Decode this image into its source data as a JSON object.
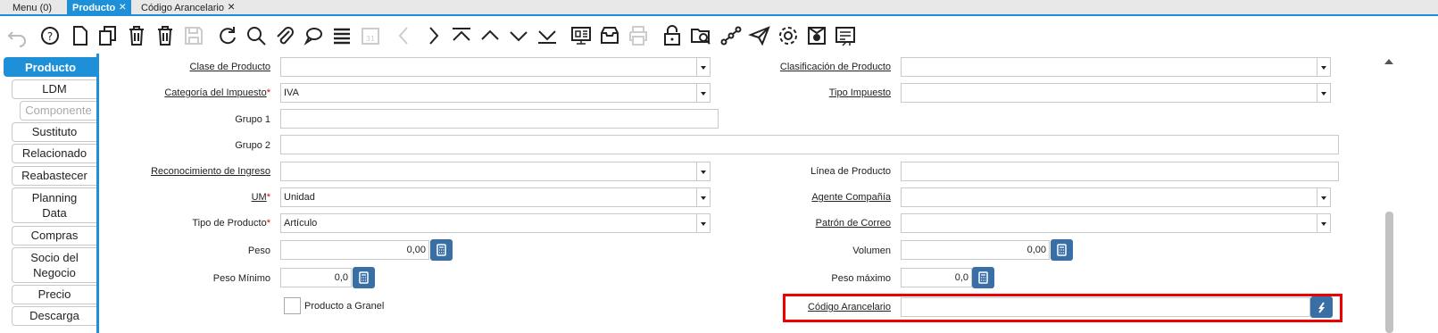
{
  "tabs": [
    {
      "label": "Menu (0)"
    },
    {
      "label": "Producto"
    },
    {
      "label": "Código Arancelario"
    }
  ],
  "toolbar": {
    "icons": [
      "undo-icon",
      "help-icon",
      "new-record-icon",
      "copy-record-icon",
      "delete-icon",
      "delete-selection-icon",
      "save-icon",
      "refresh-icon",
      "find-icon",
      "attachment-icon",
      "chat-icon",
      "grid-toggle-icon",
      "calendar-icon",
      "previous-icon",
      "next-icon",
      "first-record-icon",
      "parent-record-icon",
      "detail-record-icon",
      "last-record-icon",
      "report-icon",
      "archive-icon",
      "print-icon",
      "lock-icon",
      "zoom-across-icon",
      "workflow-icon",
      "request-icon",
      "process-icon",
      "product-info-icon",
      "export-icon"
    ]
  },
  "leftnav": {
    "items": [
      {
        "label": "Producto"
      },
      {
        "label": "LDM"
      },
      {
        "label": "Componente"
      },
      {
        "label": "Sustituto"
      },
      {
        "label": "Relacionado"
      },
      {
        "label": "Reabastecer"
      },
      {
        "label": "Planning Data"
      },
      {
        "label": "Compras"
      },
      {
        "label": "Socio del Negocio"
      },
      {
        "label": "Precio"
      },
      {
        "label": "Descarga"
      }
    ]
  },
  "form": {
    "clase_producto": {
      "label": "Clase de Producto",
      "value": ""
    },
    "clasificacion_producto": {
      "label": "Clasificación de Producto",
      "value": ""
    },
    "categoria_impuesto": {
      "label": "Categoría del Impuesto",
      "value": "IVA"
    },
    "tipo_impuesto": {
      "label": "Tipo Impuesto",
      "value": ""
    },
    "grupo1": {
      "label": "Grupo 1",
      "value": ""
    },
    "grupo2": {
      "label": "Grupo 2",
      "value": ""
    },
    "reconocimiento_ingreso": {
      "label": "Reconocimiento de Ingreso",
      "value": ""
    },
    "linea_producto": {
      "label": "Línea de Producto",
      "value": ""
    },
    "um": {
      "label": "UM",
      "value": "Unidad"
    },
    "agente_compania": {
      "label": "Agente Compañía",
      "value": ""
    },
    "tipo_producto": {
      "label": "Tipo de Producto",
      "value": "Artículo"
    },
    "patron_correo": {
      "label": "Patrón de Correo",
      "value": ""
    },
    "peso": {
      "label": "Peso",
      "value": "0,00"
    },
    "volumen": {
      "label": "Volumen",
      "value": "0,00"
    },
    "peso_minimo": {
      "label": "Peso Mínimo",
      "value": "0,0"
    },
    "peso_maximo": {
      "label": "Peso máximo",
      "value": "0,0"
    },
    "producto_granel": {
      "label": "Producto a Granel",
      "checked": false
    },
    "codigo_arancelario": {
      "label": "Código Arancelario",
      "value": ""
    },
    "required_mark": "*"
  },
  "colors": {
    "accent": "#1e90d8",
    "button": "#3a6fa6",
    "highlight": "#e00000"
  }
}
